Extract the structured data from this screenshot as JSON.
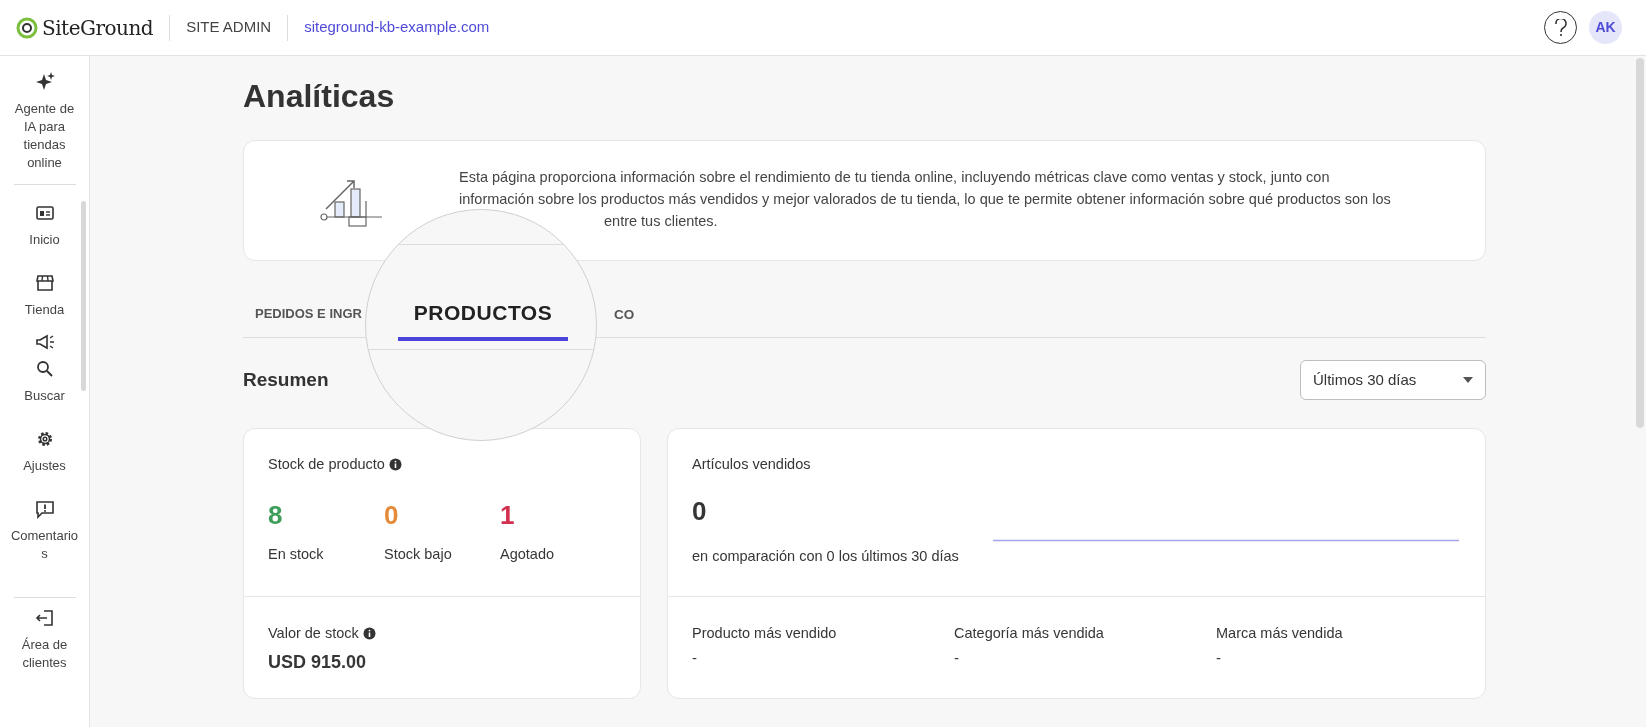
{
  "header": {
    "logo": "SiteGround",
    "section": "SITE ADMIN",
    "site": "siteground-kb-example.com",
    "avatar": "AK"
  },
  "sidebar": {
    "items": [
      {
        "label": "Agente de IA para tiendas online"
      },
      {
        "label": "Inicio"
      },
      {
        "label": "Tienda"
      },
      {
        "label": "Buscar"
      },
      {
        "label": "Ajustes"
      },
      {
        "label": "Comentario s"
      },
      {
        "label": "Área de clientes"
      }
    ]
  },
  "title": "Analíticas",
  "intro": {
    "lines": [
      "Esta página proporciona información sobre el rendimiento de tu tienda online, incluyendo métricas clave como ventas y stock, junto con",
      "información sobre los productos más vendidos y mejor valorados de tu tienda, lo que te permite obtener información sobre qué productos son los",
      "entre tus clientes."
    ]
  },
  "tabs": [
    {
      "label": "PEDIDOS E INGR",
      "selected": false
    },
    {
      "label": "PRODUCTOS",
      "selected": true
    },
    {
      "label": "CO",
      "selected": false
    }
  ],
  "summary": {
    "title": "Resumen",
    "period": "Últimos 30 días"
  },
  "stock_card": {
    "title": "Stock de producto",
    "metrics": [
      {
        "value": "8",
        "label": "En stock",
        "color": "#3f9e5a"
      },
      {
        "value": "0",
        "label": "Stock bajo",
        "color": "#e58a3a"
      },
      {
        "value": "1",
        "label": "Agotado",
        "color": "#d3304f"
      }
    ],
    "value_label": "Valor de stock",
    "value": "USD 915.00"
  },
  "sold_card": {
    "title": "Artículos vendidos",
    "value": "0",
    "comparison": "en comparación con 0 los últimos 30 días",
    "tops": [
      {
        "label": "Producto más vendido",
        "value": "-"
      },
      {
        "label": "Categoría más vendida",
        "value": "-"
      },
      {
        "label": "Marca más vendida",
        "value": "-"
      }
    ]
  }
}
